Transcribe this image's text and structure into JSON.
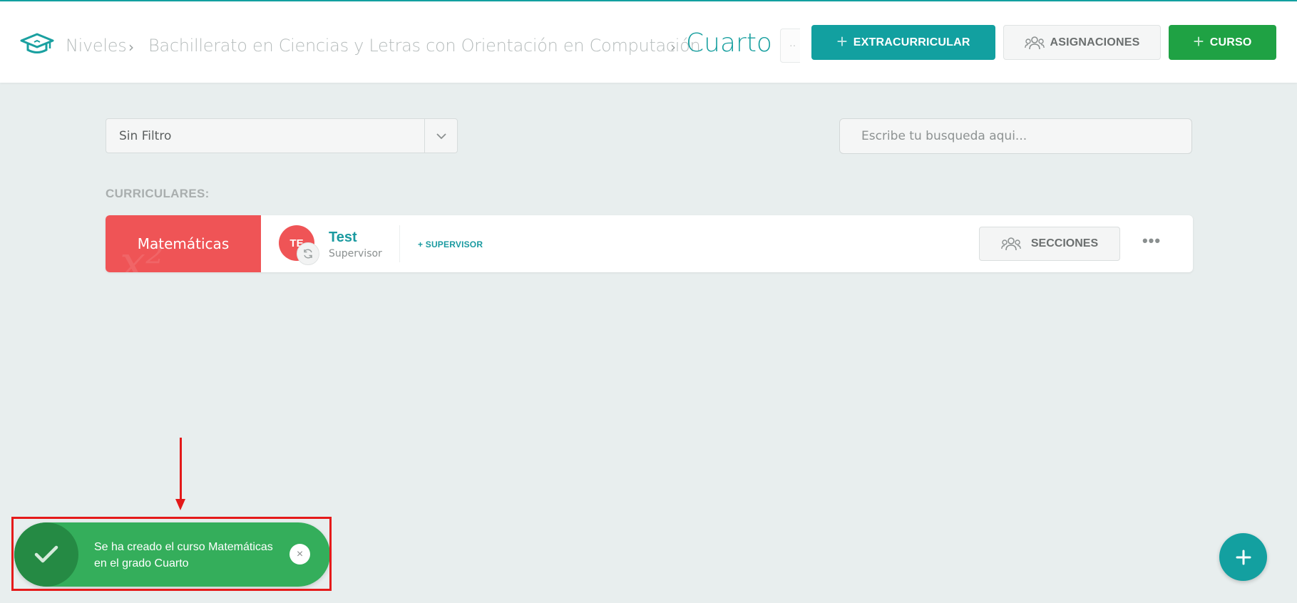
{
  "header": {
    "breadcrumb": [
      "Niveles",
      "Bachillerato en Ciencias y Letras con Orientación en Computación"
    ],
    "separator": "›",
    "current": "Cuarto",
    "more_dots": "··",
    "buttons": {
      "extracurricular": "EXTRACURRICULAR",
      "asignaciones": "ASIGNACIONES",
      "curso": "CURSO"
    },
    "plus_glyph": "+"
  },
  "filters": {
    "select_value": "Sin Filtro",
    "search_placeholder": "Escribe tu busqueda aqui..."
  },
  "section": {
    "label": "CURRICULARES:"
  },
  "courses": [
    {
      "name": "Matemáticas",
      "color": "#ef5456",
      "supervisor": {
        "initials": "TE",
        "name": "Test",
        "role": "Supervisor"
      },
      "add_supervisor": "+ SUPERVISOR",
      "sections_button": "SECCIONES",
      "more": "•••"
    }
  ],
  "toast": {
    "message": "Se ha creado el curso Matemáticas en el grado Cuarto",
    "close": "×",
    "color": "#34ae5b"
  },
  "colors": {
    "teal": "#12a0a0",
    "green": "#1fa244",
    "annotation_red": "#e31919"
  }
}
